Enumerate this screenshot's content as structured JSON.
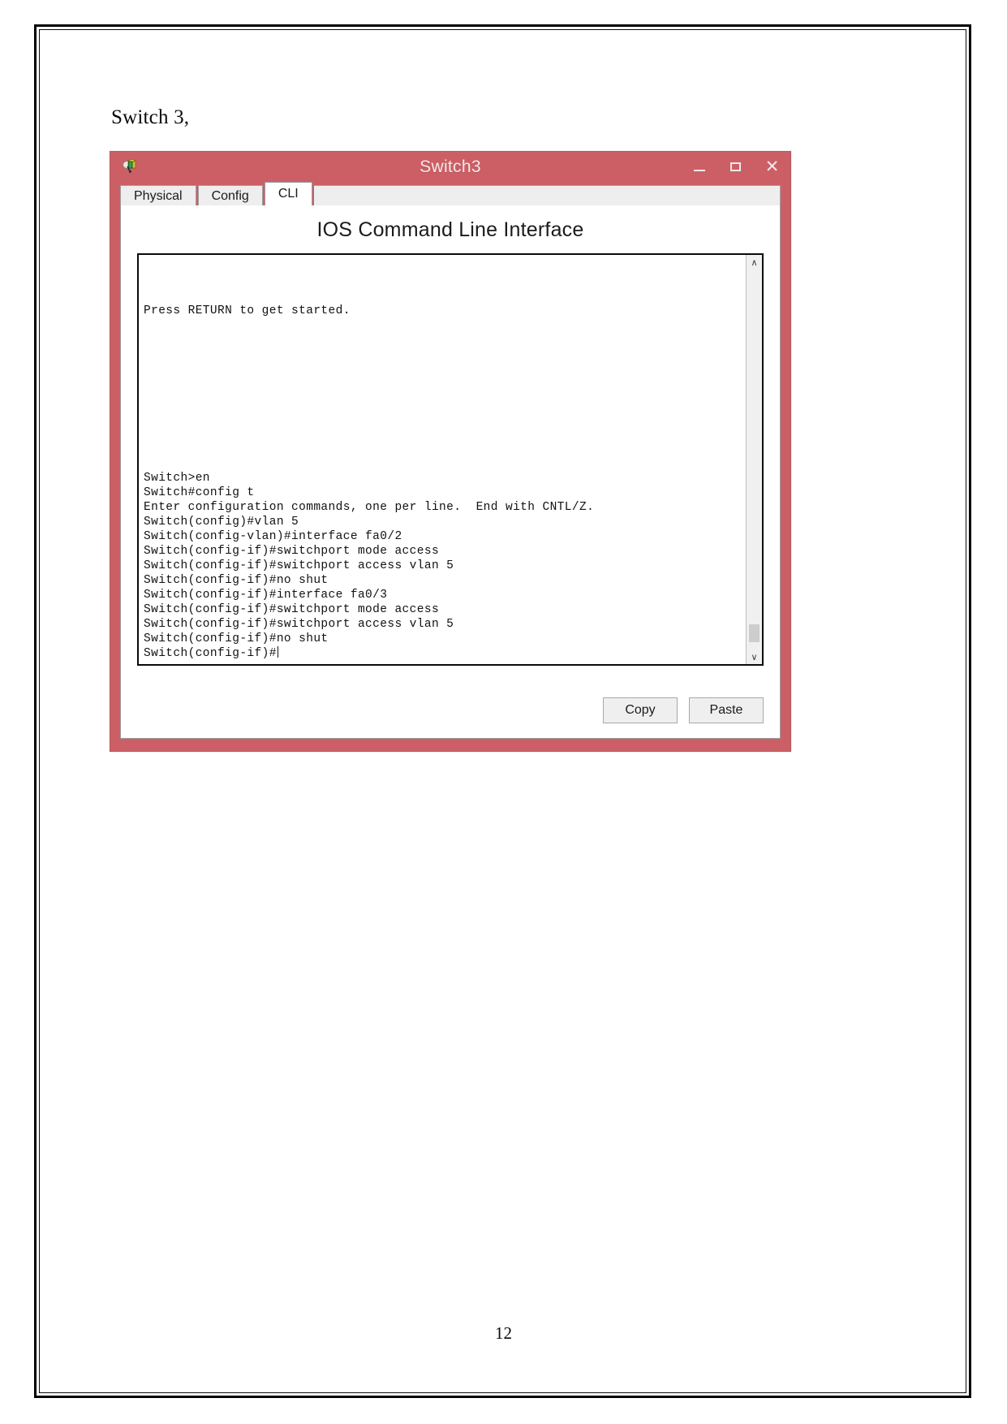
{
  "document": {
    "caption": "Switch 3,",
    "page_number": "12"
  },
  "window": {
    "title": "Switch3",
    "icon": "packet-tracer-switch-icon",
    "titlebar_color": "#cc5f66",
    "controls": {
      "minimize": "–",
      "maximize": "□",
      "close": "✕"
    }
  },
  "tabs": [
    {
      "label": "Physical",
      "active": false
    },
    {
      "label": "Config",
      "active": false
    },
    {
      "label": "CLI",
      "active": true
    }
  ],
  "panel": {
    "heading": "IOS Command Line Interface"
  },
  "terminal": {
    "intro_lines": [
      "Press RETURN to get started."
    ],
    "command_lines": [
      "Switch>en",
      "Switch#config t",
      "Enter configuration commands, one per line.  End with CNTL/Z.",
      "Switch(config)#vlan 5",
      "Switch(config-vlan)#interface fa0/2",
      "Switch(config-if)#switchport mode access",
      "Switch(config-if)#switchport access vlan 5",
      "Switch(config-if)#no shut",
      "Switch(config-if)#interface fa0/3",
      "Switch(config-if)#switchport mode access",
      "Switch(config-if)#switchport access vlan 5",
      "Switch(config-if)#no shut"
    ],
    "prompt_line": "Switch(config-if)#",
    "scrollbar": {
      "up_arrow": "∧",
      "down_arrow": "∨"
    }
  },
  "actions": {
    "copy_label": "Copy",
    "paste_label": "Paste"
  }
}
